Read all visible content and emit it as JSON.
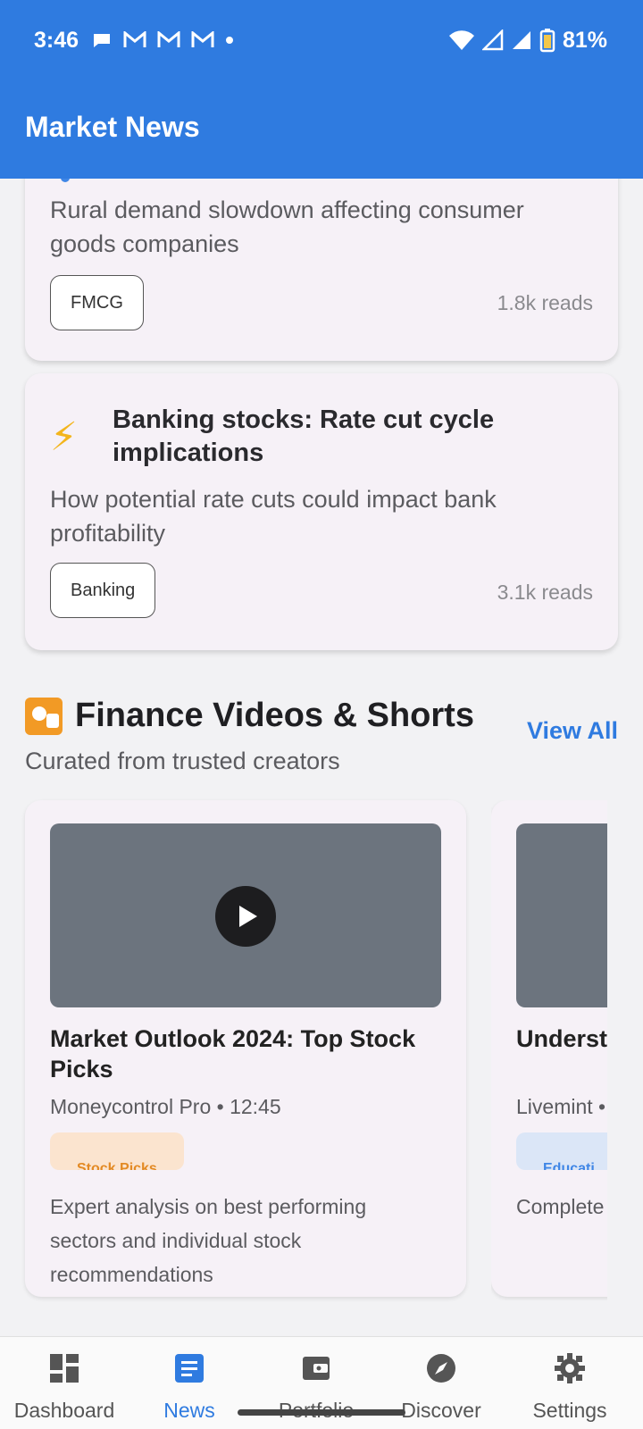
{
  "status_bar": {
    "time": "3:46",
    "battery": "81%",
    "notification_icons": [
      "chat-bubble-icon",
      "gmail-icon",
      "gmail-icon",
      "gmail-icon",
      "dot-icon"
    ],
    "system_icons": [
      "wifi-icon",
      "signal-icon",
      "signal-icon",
      "battery-icon"
    ]
  },
  "app_bar": {
    "title": "Market News"
  },
  "news": [
    {
      "desc": "Rural demand slowdown affecting consumer goods companies",
      "tag": "FMCG",
      "reads": "1.8k reads"
    },
    {
      "emoji": "⚡",
      "title": "Banking stocks: Rate cut cycle implications",
      "desc": "How potential rate cuts could impact bank profitability",
      "tag": "Banking",
      "reads": "3.1k reads"
    }
  ],
  "videos_section": {
    "title": "Finance Videos & Shorts",
    "subtitle": "Curated from trusted creators",
    "view_all": "View All",
    "videos": [
      {
        "title": "Market Outlook 2024: Top Stock Picks",
        "meta": "Moneycontrol Pro • 12:45",
        "chip": "Stock Picks",
        "desc": "Expert analysis on best performing sectors and individual stock recommendations"
      },
      {
        "title": "Underst for Begi",
        "meta": "Livemint •",
        "chip": "Educati",
        "desc": "Complete strategies"
      }
    ]
  },
  "bottom_nav": [
    {
      "label": "Dashboard",
      "icon": "dashboard-icon"
    },
    {
      "label": "News",
      "icon": "news-icon",
      "active": true
    },
    {
      "label": "Portfolio",
      "icon": "wallet-icon"
    },
    {
      "label": "Discover",
      "icon": "compass-icon"
    },
    {
      "label": "Settings",
      "icon": "gear-icon"
    }
  ],
  "colors": {
    "primary": "#2f7be0",
    "card_bg": "#f6f1f7",
    "chip_orange": "#fbe4cf",
    "chip_blue": "#dbe6f7"
  }
}
